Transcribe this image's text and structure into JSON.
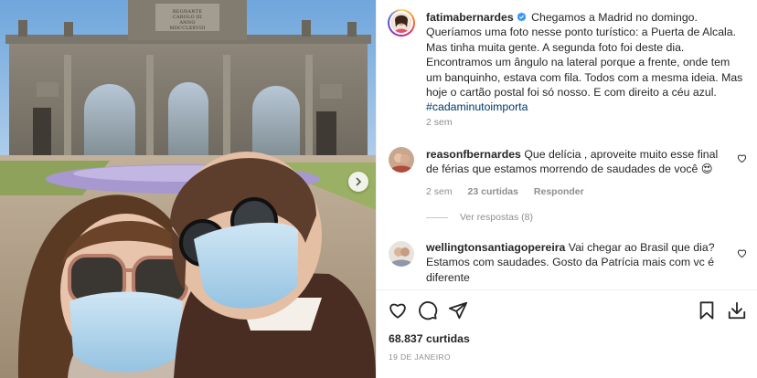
{
  "monument_inscription": "REGNANTE\nCAROLO III\nANNO\nMDCCLXXVIII",
  "post": {
    "author": "fatimabernardes",
    "verified": true,
    "caption": "Chegamos a Madrid no domingo. Queríamos uma foto nesse ponto turístico: a Puerta de Alcala. Mas tinha muita gente. A segunda foto foi deste dia. Encontramos um ângulo na lateral porque a frente, onde tem um banquinho, estava com fila. Todos com a mesma ideia. Mas hoje o cartão postal foi só nosso. E com direito a céu azul.",
    "hashtag": "#cadaminutoimporta",
    "age": "2 sem",
    "likes": "68.837 curtidas",
    "date": "19 DE JANEIRO"
  },
  "comments": [
    {
      "username": "reasonfbernardes",
      "text": "Que delícia , aproveite muito esse final de férias que estamos morrendo de saudades de você 😍",
      "age": "2 sem",
      "likes": "23 curtidas",
      "reply_label": "Responder",
      "view_replies": "Ver respostas (8)"
    },
    {
      "username": "wellingtonsantiagopereira",
      "text": "Vai chegar ao Brasil que dia? Estamos com saudades. Gosto da Patrícia mais com vc é diferente"
    }
  ],
  "icons": {
    "like": "heart-icon",
    "comment": "comment-icon",
    "share": "paper-plane-icon",
    "save": "bookmark-icon",
    "download": "download-icon",
    "carousel_next": "chevron-right-icon",
    "verified": "verified-badge-icon"
  },
  "colors": {
    "verified_blue": "#3897f0",
    "hashtag_link": "#00376b",
    "muted_text": "#8e8e8e"
  }
}
